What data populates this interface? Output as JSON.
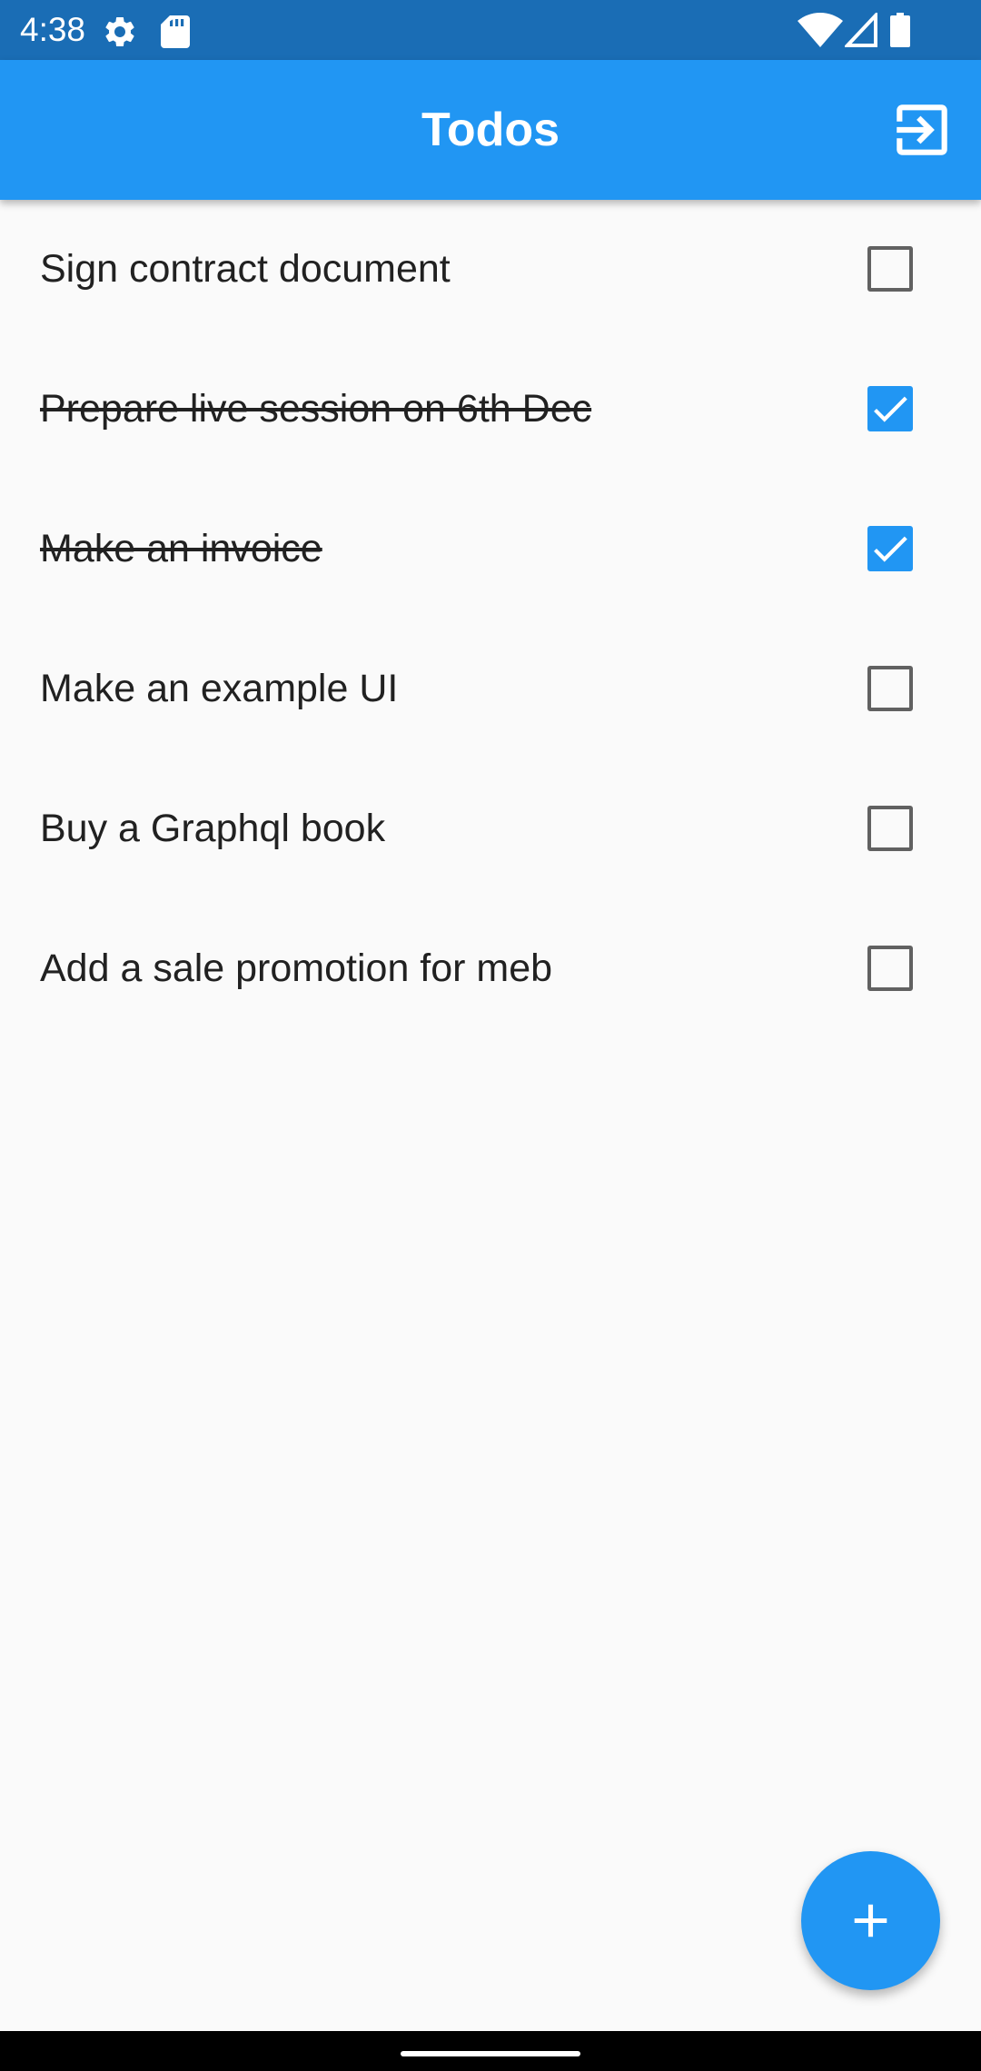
{
  "status_bar": {
    "time": "4:38",
    "left_icons": [
      "gear-icon",
      "sd-card-icon"
    ],
    "right_icons": [
      "wifi-icon",
      "cell-signal-icon",
      "battery-icon"
    ]
  },
  "app_bar": {
    "title": "Todos",
    "action_icon": "logout-icon"
  },
  "todos": [
    {
      "text": "Sign contract document",
      "done": false
    },
    {
      "text": "Prepare live session on 6th Dec",
      "done": true
    },
    {
      "text": "Make an invoice",
      "done": true
    },
    {
      "text": "Make an example UI",
      "done": false
    },
    {
      "text": "Buy a Graphql book",
      "done": false
    },
    {
      "text": "Add a sale promotion for meb",
      "done": false
    }
  ],
  "fab": {
    "icon": "plus-icon"
  },
  "colors": {
    "status_bar": "#1a6db5",
    "primary": "#2196f3",
    "background": "#fafafa",
    "text": "#212121",
    "checkbox_border": "#616161",
    "nav_bar": "#000000"
  }
}
